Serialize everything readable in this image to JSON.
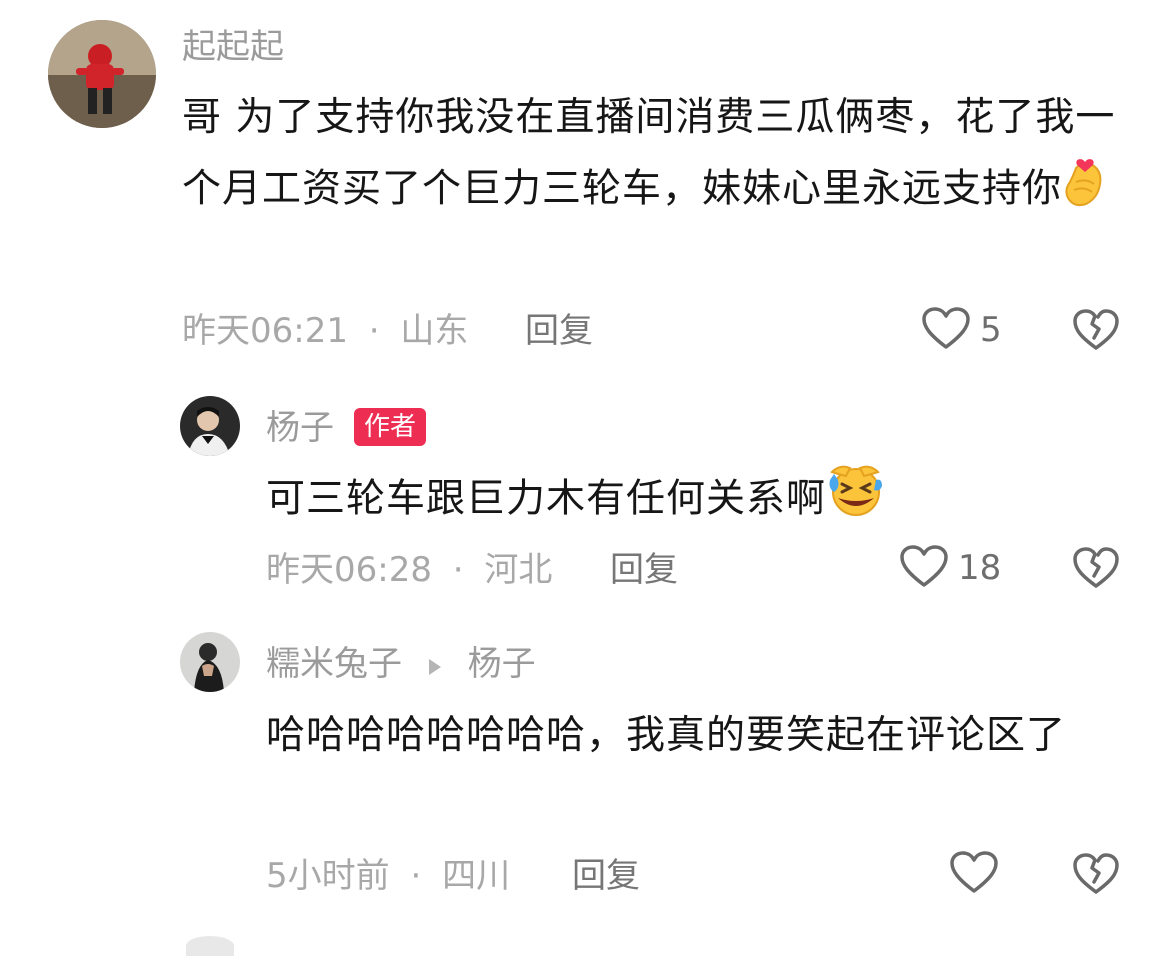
{
  "comments": [
    {
      "username": "起起起",
      "text": "哥 为了支持你我没在直播间消费三瓜俩枣，花了我一个月工资买了个巨力三轮车，妹妹心里永远支持你",
      "emoji": "finger-heart-icon",
      "time": "昨天06:21",
      "location": "山东",
      "reply_label": "回复",
      "likes": "5"
    },
    {
      "username": "杨子",
      "badge": "作者",
      "text": "可三轮车跟巨力木有任何关系啊",
      "emoji": "laughing-tears-icon",
      "time": "昨天06:28",
      "location": "河北",
      "reply_label": "回复",
      "likes": "18"
    },
    {
      "username": "糯米兔子",
      "reply_to": "杨子",
      "text": "哈哈哈哈哈哈哈哈，我真的要笑起在评论区了",
      "time": "5小时前",
      "location": "四川",
      "reply_label": "回复",
      "likes": ""
    }
  ],
  "separator": "·",
  "colors": {
    "badge_bg": "#ee2d52",
    "username": "#9b9b9b",
    "body_text": "#161616",
    "meta": "#a8a8a8"
  }
}
